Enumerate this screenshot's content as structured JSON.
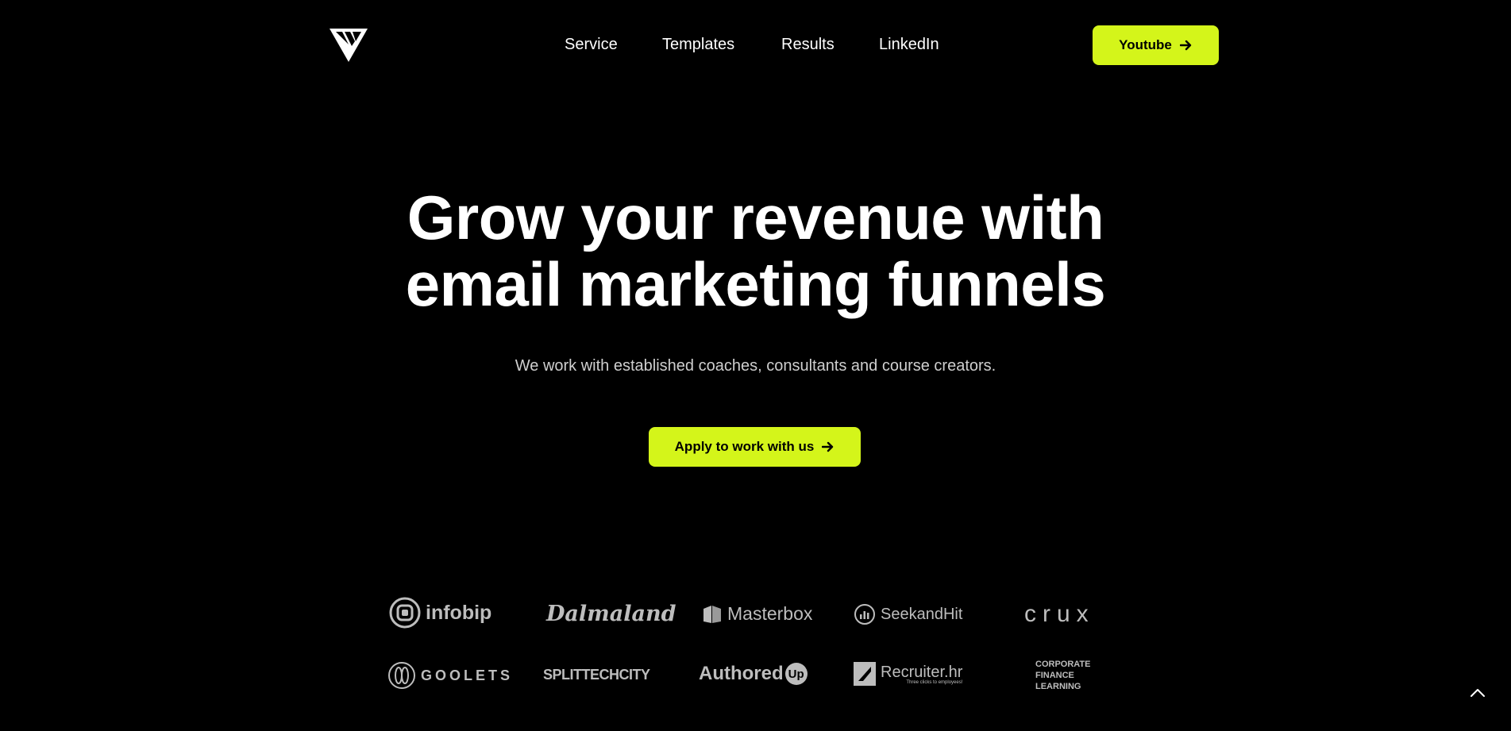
{
  "header": {
    "logo_icon": "triangle-monogram-icon",
    "nav": [
      {
        "label": "Service"
      },
      {
        "label": "Templates"
      },
      {
        "label": "Results"
      },
      {
        "label": "LinkedIn"
      }
    ],
    "cta_label": "Youtube",
    "cta_icon": "arrow-right-icon"
  },
  "hero": {
    "title_line1": "Grow your revenue with",
    "title_line2": "email marketing funnels",
    "subtitle": "We work with established coaches, consultants and course creators.",
    "cta_label": "Apply to work with us",
    "cta_icon": "arrow-right-icon"
  },
  "clients": {
    "row1": [
      "infobip",
      "Dalmaland",
      "Masterbox",
      "SeekandHit",
      "crux"
    ],
    "row2": [
      "GOOLETS",
      "SPLITTECHCITY",
      "Authored",
      "Recruiter.hr"
    ],
    "authored_suffix": "Up",
    "recruiter_tagline": "Three clicks to employees!",
    "cfl": [
      "CORPORATE",
      "FINANCE",
      "LEARNING"
    ]
  },
  "scroll_top_icon": "chevron-up-icon",
  "colors": {
    "background": "#000000",
    "accent": "#d4f51a",
    "text": "#ffffff",
    "muted": "#cfcfcf",
    "logo_grey": "#bdbdbd"
  }
}
